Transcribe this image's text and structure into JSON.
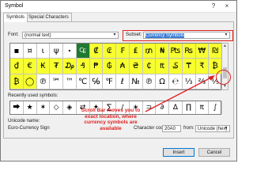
{
  "window": {
    "title": "Symbol",
    "help_icon": "?",
    "close_icon": "×"
  },
  "tabs": [
    {
      "label": "Symbols"
    },
    {
      "label": "Special Characters"
    }
  ],
  "font": {
    "label": "Font:",
    "value": "(normal text)"
  },
  "subset": {
    "label": "Subset:",
    "value": "Currency Symbols"
  },
  "symbol_rows": [
    [
      "▪",
      "¤",
      "ι",
      "ψ",
      "⬝",
      "₠",
      "₡",
      "₢",
      "₣",
      "₤",
      "₥",
      "₦",
      "₧",
      "₨",
      "₩",
      "₪"
    ],
    [
      "₫",
      "€",
      "₭",
      "₮",
      "₯",
      "₰",
      "₱",
      "₲",
      "₳",
      "₴",
      "₵",
      "₶",
      "₷",
      "₸",
      "₹",
      "₿"
    ],
    [
      "₿",
      "◯",
      "℗",
      "℠",
      "™",
      "℃",
      "℅",
      "℉",
      "ℓ",
      "№",
      "℗",
      "Ω",
      "℮",
      "⅓",
      "⅔",
      "⅕"
    ]
  ],
  "recent": {
    "label": "Recently used symbols:",
    "symbols": [
      "⮕",
      "★",
      "✶",
      "◇",
      "◈",
      "⇄",
      "✦",
      "∑",
      "∕",
      "∗",
      "⊃",
      "∂",
      "∆",
      "∏",
      "₶",
      "∫"
    ]
  },
  "unicode_name": {
    "label": "Unicode name:",
    "value": "Euro-Currency Sign"
  },
  "char_code": {
    "label": "Character code:",
    "value": "20A0"
  },
  "from": {
    "label": "from:",
    "value": "Unicode (hex)"
  },
  "buttons": {
    "insert": "Insert",
    "cancel": "Cancel"
  },
  "annotation": {
    "text": "Scroll Bar moves you to exact location, where currency symbols are available"
  },
  "colors": {
    "highlight_yellow": "#f7ff2e",
    "selected_green": "#1f7a30",
    "annotation_red": "#e02020"
  }
}
